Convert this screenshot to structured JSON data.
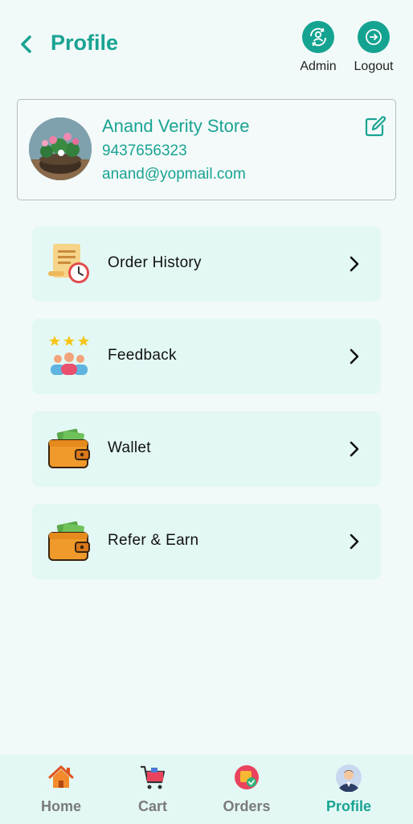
{
  "header": {
    "title": "Profile",
    "actions": [
      {
        "label": "Admin",
        "icon": "admin-switch-icon"
      },
      {
        "label": "Logout",
        "icon": "logout-icon"
      }
    ]
  },
  "store": {
    "name": "Anand Verity Store",
    "phone": "9437656323",
    "email": "anand@yopmail.com"
  },
  "menu": [
    {
      "label": "Order History",
      "icon": "order-history-icon"
    },
    {
      "label": "Feedback",
      "icon": "feedback-icon"
    },
    {
      "label": "Wallet",
      "icon": "wallet-icon"
    },
    {
      "label": "Refer & Earn",
      "icon": "wallet-icon"
    }
  ],
  "bottom_nav": [
    {
      "label": "Home",
      "icon": "home-icon"
    },
    {
      "label": "Cart",
      "icon": "cart-icon"
    },
    {
      "label": "Orders",
      "icon": "orders-icon"
    },
    {
      "label": "Profile",
      "icon": "profile-icon",
      "active": true
    }
  ],
  "colors": {
    "accent": "#1aa393",
    "background": "#f2faf9",
    "card": "#e3f8f4",
    "inactive_nav": "#7a7a7a"
  }
}
